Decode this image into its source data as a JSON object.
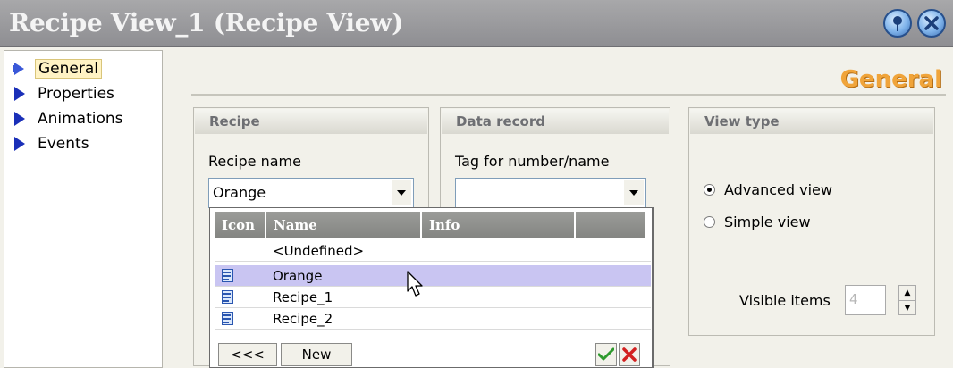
{
  "window": {
    "title": "Recipe View_1 (Recipe View)"
  },
  "nav": {
    "items": [
      {
        "label": "General",
        "selected": true
      },
      {
        "label": "Properties",
        "selected": false
      },
      {
        "label": "Animations",
        "selected": false
      },
      {
        "label": "Events",
        "selected": false
      }
    ]
  },
  "section_title": "General",
  "recipe_group": {
    "header": "Recipe",
    "name_label": "Recipe name",
    "selected_value": "Orange"
  },
  "data_record_group": {
    "header": "Data record",
    "tag_label": "Tag for number/name",
    "selected_value": ""
  },
  "view_type_group": {
    "header": "View type",
    "options": [
      {
        "label": "Advanced view",
        "checked": true
      },
      {
        "label": "Simple view",
        "checked": false
      }
    ],
    "visible_items_label": "Visible items",
    "visible_items_value": "4"
  },
  "recipe_dropdown": {
    "columns": [
      "Icon",
      "Name",
      "Info",
      ""
    ],
    "rows": [
      {
        "icon": "",
        "name": "<Undefined>",
        "info": "",
        "selected": false
      },
      {
        "icon": "recipe-icon",
        "name": "Orange",
        "info": "",
        "selected": true
      },
      {
        "icon": "recipe-icon",
        "name": "Recipe_1",
        "info": "",
        "selected": false
      },
      {
        "icon": "recipe-icon",
        "name": "Recipe_2",
        "info": "",
        "selected": false
      }
    ],
    "back_label": "<<<",
    "new_label": "New"
  },
  "colors": {
    "accent_orange": "#f0a43a",
    "selection": "#c9c5f2",
    "nav_arrow": "#1a2fb8",
    "nav_selected_arrow": "#3a58d8"
  }
}
